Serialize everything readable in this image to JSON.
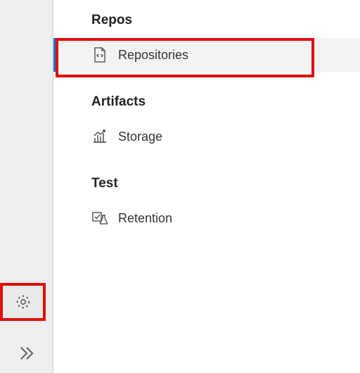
{
  "sidebar": {
    "sections": [
      {
        "title": "Repos",
        "items": [
          {
            "icon": "code-file-icon",
            "label": "Repositories",
            "selected": true
          }
        ]
      },
      {
        "title": "Artifacts",
        "items": [
          {
            "icon": "storage-chart-icon",
            "label": "Storage",
            "selected": false
          }
        ]
      },
      {
        "title": "Test",
        "items": [
          {
            "icon": "retention-flask-icon",
            "label": "Retention",
            "selected": false
          }
        ]
      }
    ],
    "rail": {
      "settings_label": "Settings",
      "expand_label": "Expand"
    }
  }
}
